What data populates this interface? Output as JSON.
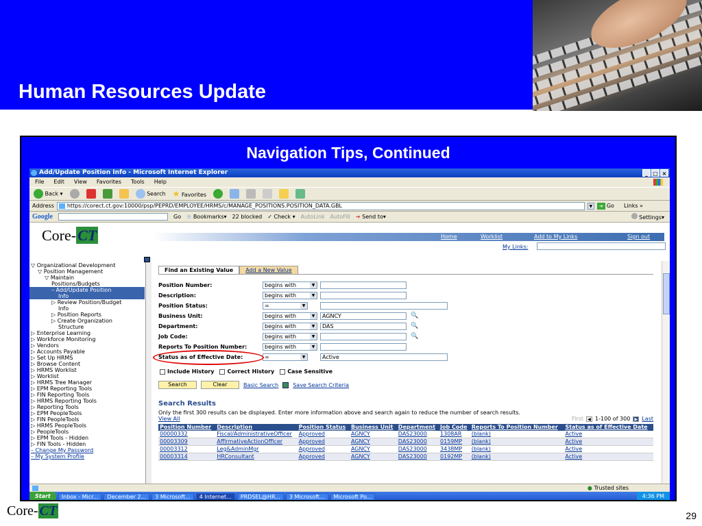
{
  "slide": {
    "title": "Human Resources Update",
    "subtitle": "Navigation Tips, Continued",
    "page_number": "29",
    "footer_logo_text": "Core-",
    "footer_logo_mark": "CT"
  },
  "browser": {
    "window_title": "Add/Update Position Info - Microsoft Internet Explorer",
    "window_buttons": [
      "_",
      "□",
      "×"
    ],
    "menu": [
      "File",
      "Edit",
      "View",
      "Favorites",
      "Tools",
      "Help"
    ],
    "toolbar": {
      "back": "Back",
      "search": "Search",
      "favorites": "Favorites"
    },
    "address_label": "Address",
    "address_url": "https://corect.ct.gov:10000/psp/PEPRD/EMPLOYEE/HRMS/c/MANAGE_POSITIONS.POSITION_DATA.GBL",
    "go_label": "Go",
    "links_label": "Links »",
    "google": {
      "logo": "Google",
      "go": "Go",
      "bookmarks": "Bookmarks",
      "blocked": "22 blocked",
      "check": "Check",
      "autolink": "AutoLink",
      "autofill": "AutoFill",
      "send_to": "Send to",
      "settings": "Settings"
    }
  },
  "app": {
    "logo_text": "Core-",
    "logo_mark": "CT",
    "nav_links": [
      "Home",
      "Worklist",
      "Add to My Links",
      "Sign out"
    ],
    "my_links_label": "My Links:",
    "sidebar": [
      {
        "label": "▽ Organizational Development",
        "indent": 0,
        "type": "node"
      },
      {
        "label": "▽ Position Management",
        "indent": 1,
        "type": "node"
      },
      {
        "label": "▽ Maintain",
        "indent": 2,
        "type": "node"
      },
      {
        "label": "Positions/Budgets",
        "indent": 3,
        "type": "node"
      },
      {
        "label": "– Add/Update Position",
        "indent": 3,
        "type": "sel"
      },
      {
        "label": "Info",
        "indent": 4,
        "type": "sel"
      },
      {
        "label": "▷ Review Position/Budget",
        "indent": 3,
        "type": "node"
      },
      {
        "label": "Info",
        "indent": 4,
        "type": "node"
      },
      {
        "label": "▷ Position Reports",
        "indent": 3,
        "type": "node"
      },
      {
        "label": "▷ Create Organization",
        "indent": 3,
        "type": "node"
      },
      {
        "label": "Structure",
        "indent": 4,
        "type": "node"
      },
      {
        "label": "▷ Enterprise Learning",
        "indent": 0,
        "type": "node"
      },
      {
        "label": "▷ Workforce Monitoring",
        "indent": 0,
        "type": "node"
      },
      {
        "label": "▷ Vendors",
        "indent": 0,
        "type": "node"
      },
      {
        "label": "▷ Accounts Payable",
        "indent": 0,
        "type": "node"
      },
      {
        "label": "▷ Set Up HRMS",
        "indent": 0,
        "type": "node"
      },
      {
        "label": "▷ Browse Content",
        "indent": 0,
        "type": "node"
      },
      {
        "label": "▷ HRMS Worklist",
        "indent": 0,
        "type": "node"
      },
      {
        "label": "▷ Worklist",
        "indent": 0,
        "type": "node"
      },
      {
        "label": "▷ HRMS Tree Manager",
        "indent": 0,
        "type": "node"
      },
      {
        "label": "▷ EPM Reporting Tools",
        "indent": 0,
        "type": "node"
      },
      {
        "label": "▷ FIN Reporting Tools",
        "indent": 0,
        "type": "node"
      },
      {
        "label": "▷ HRMS Reporting Tools",
        "indent": 0,
        "type": "node"
      },
      {
        "label": "▷ Reporting Tools",
        "indent": 0,
        "type": "node"
      },
      {
        "label": "▷ EPM PeopleTools",
        "indent": 0,
        "type": "node"
      },
      {
        "label": "▷ FIN PeopleTools",
        "indent": 0,
        "type": "node"
      },
      {
        "label": "▷ HRMS PeopleTools",
        "indent": 0,
        "type": "node"
      },
      {
        "label": "▷ PeopleTools",
        "indent": 0,
        "type": "node"
      },
      {
        "label": "▷ EPM Tools - Hidden",
        "indent": 0,
        "type": "node"
      },
      {
        "label": "▷ FIN Tools - Hidden",
        "indent": 0,
        "type": "node"
      },
      {
        "label": "– Change My Password",
        "indent": 0,
        "type": "link"
      },
      {
        "label": "– My System Profile",
        "indent": 0,
        "type": "link"
      }
    ],
    "tabs": [
      "Find an Existing Value",
      "Add a New Value"
    ],
    "fields": [
      {
        "label": "Position Number:",
        "op": "begins with",
        "value": "",
        "lookup": false,
        "wide": false
      },
      {
        "label": "Description:",
        "op": "begins with",
        "value": "",
        "lookup": false,
        "wide": false
      },
      {
        "label": "Position Status:",
        "op": "=",
        "value": "",
        "lookup": false,
        "wide": true
      },
      {
        "label": "Business Unit:",
        "op": "begins with",
        "value": "AGNCY",
        "lookup": true,
        "wide": false
      },
      {
        "label": "Department:",
        "op": "begins with",
        "value": "DAS",
        "lookup": true,
        "wide": false
      },
      {
        "label": "Job Code:",
        "op": "begins with",
        "value": "",
        "lookup": true,
        "wide": false
      },
      {
        "label": "Reports To Position Number:",
        "op": "begins with",
        "value": "",
        "lookup": false,
        "wide": false
      },
      {
        "label": "Status as of Effective Date:",
        "op": "=",
        "value": "Active",
        "lookup": false,
        "wide": true
      }
    ],
    "checkboxes": [
      "Include History",
      "Correct History",
      "Case Sensitive"
    ],
    "buttons": {
      "search": "Search",
      "clear": "Clear",
      "basic_search": "Basic Search",
      "save_criteria": "Save Search Criteria"
    },
    "results": {
      "title": "Search Results",
      "note": "Only the first 300 results can be displayed. Enter more information above and search again to reduce the number of search results.",
      "view_all": "View All",
      "first": "First",
      "range": "1-100 of 300",
      "last": "Last",
      "columns": [
        "Position Number",
        "Description",
        "Position Status",
        "Business Unit",
        "Department",
        "Job Code",
        "Reports To Position Number",
        "Status as of Effective Date"
      ],
      "rows": [
        [
          "00000332",
          "Fiscal/AdministrativeOfficer",
          "Approved",
          "AGNCY",
          "DAS23000",
          "1308AR",
          "(blank)",
          "Active"
        ],
        [
          "00003309",
          "AffirmativeActionOfficer",
          "Approved",
          "AGNCY",
          "DAS23000",
          "0159MP",
          "(blank)",
          "Active"
        ],
        [
          "00003312",
          "Leg&AdminMgr",
          "Approved",
          "AGNCY",
          "DAS23000",
          "3438MP",
          "(blank)",
          "Active"
        ],
        [
          "00003314",
          "HRConsultant",
          "Approved",
          "AGNCY",
          "DAS23000",
          "0192MP",
          "(blank)",
          "Active"
        ]
      ]
    }
  },
  "status_bar": {
    "zone": "Trusted sites"
  },
  "taskbar": {
    "start": "Start",
    "tasks": [
      "Inbox - Micr...",
      "December 2...",
      "3 Microsoft...",
      "4 Internet...",
      "PRDSEL@HR...",
      "3 Microsoft...",
      "Microsoft Po..."
    ],
    "active_task": 3,
    "clock": "4:36 PM"
  }
}
